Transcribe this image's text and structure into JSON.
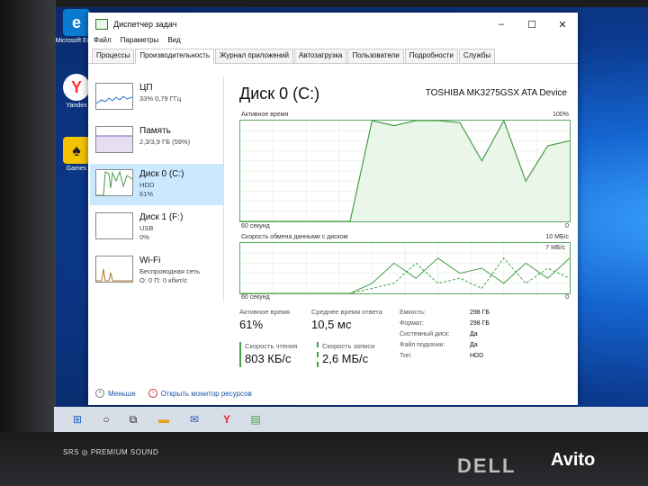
{
  "desktop": {
    "icons": [
      {
        "label": "Microsoft Edge",
        "icon": "edge-icon"
      },
      {
        "label": "Yandex",
        "icon": "yandex-icon"
      },
      {
        "label": "Games",
        "icon": "games-icon"
      }
    ]
  },
  "window": {
    "title": "Диспетчер задач",
    "controls": {
      "minimize": "–",
      "maximize": "☐",
      "close": "✕"
    },
    "menu": [
      "Файл",
      "Параметры",
      "Вид"
    ],
    "tabs": [
      "Процессы",
      "Производительность",
      "Журнал приложений",
      "Автозагрузка",
      "Пользователи",
      "Подробности",
      "Службы"
    ],
    "active_tab": "Производительность"
  },
  "sidebar": {
    "items": [
      {
        "name": "ЦП",
        "line1": "33% 0,79 ГГц",
        "line2": ""
      },
      {
        "name": "Память",
        "line1": "2,3/3,9 ГБ (59%)",
        "line2": ""
      },
      {
        "name": "Диск 0 (C:)",
        "line1": "HDD",
        "line2": "61%"
      },
      {
        "name": "Диск 1 (F:)",
        "line1": "USB",
        "line2": "0%"
      },
      {
        "name": "Wi-Fi",
        "line1": "Беспроводная сеть",
        "line2": "О: 0 П: 0 кбит/с"
      }
    ]
  },
  "main": {
    "title": "Диск 0 (C:)",
    "device": "TOSHIBA MK3275GSX ATA Device",
    "graph1": {
      "label": "Активное время",
      "max": "100%",
      "time": "60 секунд",
      "min": "0"
    },
    "graph2": {
      "label": "Скорость обмена данными с диском",
      "max": "10 МБ/с",
      "sub_max": "7 МБ/с",
      "time": "60 секунд",
      "min": "0"
    },
    "stats": {
      "active_label": "Активное время",
      "active_value": "61%",
      "response_label": "Среднее время ответа",
      "response_value": "10,5 мс",
      "read_label": "Скорость чтения",
      "read_value": "803 КБ/с",
      "write_label": "Скорость записи",
      "write_value": "2,6 МБ/с"
    },
    "properties": [
      {
        "k": "Емкость:",
        "v": "298 ГБ"
      },
      {
        "k": "Формат:",
        "v": "298 ГБ"
      },
      {
        "k": "Системный диск:",
        "v": "Да"
      },
      {
        "k": "Файл подкачки:",
        "v": "Да"
      },
      {
        "k": "Тип:",
        "v": "HDD"
      }
    ]
  },
  "footer": {
    "less": "Меньше",
    "open_monitor": "Открыть монитор ресурсов"
  },
  "laptop": {
    "speaker_text": "SRS ◎ PREMIUM SOUND",
    "brand": "DELL",
    "watermark": "Avito"
  },
  "colors": {
    "accent_green": "#4a9e4a",
    "select_blue": "#cce8ff",
    "link_blue": "#1a55a8"
  },
  "chart_data": [
    {
      "type": "area",
      "title": "Активное время",
      "ylim": [
        0,
        100
      ],
      "x": [
        0,
        4,
        7,
        10,
        13,
        16,
        20,
        24,
        28,
        32,
        36,
        40,
        44,
        48,
        52,
        56,
        60
      ],
      "values": [
        0,
        0,
        0,
        0,
        0,
        0,
        0,
        100,
        95,
        100,
        100,
        98,
        60,
        100,
        40,
        75,
        80
      ]
    },
    {
      "type": "line",
      "title": "Скорость обмена данными с диском",
      "ylim": [
        0,
        10
      ],
      "x": [
        0,
        4,
        7,
        10,
        13,
        16,
        20,
        24,
        28,
        32,
        36,
        40,
        44,
        48,
        52,
        56,
        60
      ],
      "series": [
        {
          "values": [
            0,
            0,
            0,
            0,
            0,
            0,
            0,
            2,
            6,
            3,
            7,
            4,
            5,
            2,
            6,
            3,
            7
          ]
        },
        {
          "values": [
            0,
            0,
            0,
            0,
            0,
            0,
            0,
            1,
            2,
            6,
            2,
            3,
            1,
            7,
            2,
            5,
            3
          ]
        }
      ]
    }
  ]
}
